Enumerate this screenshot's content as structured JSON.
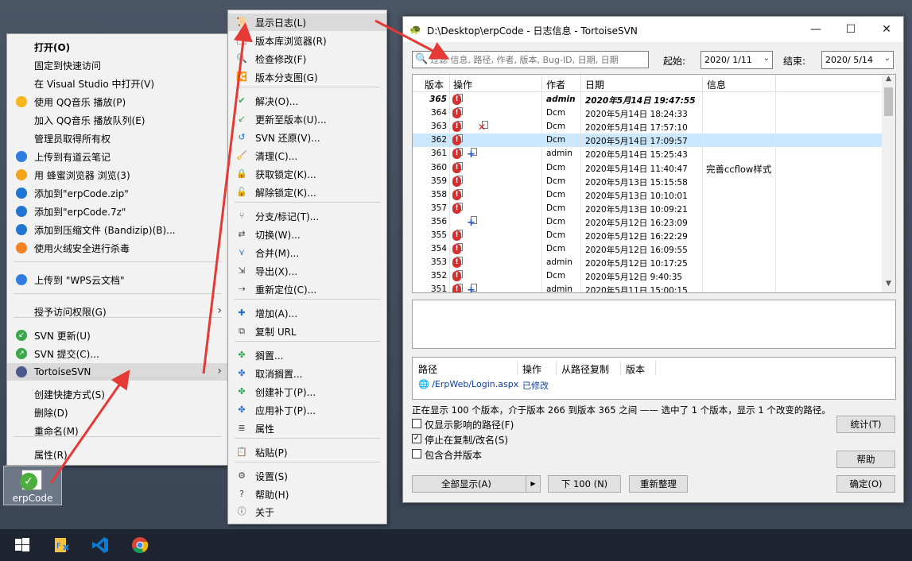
{
  "desktop_icon": {
    "label": "erpCode"
  },
  "context_menu": {
    "items": [
      {
        "label": "打开(O)",
        "bold": true
      },
      {
        "label": "固定到快速访问"
      },
      {
        "label": "在 Visual Studio 中打开(V)"
      },
      {
        "label": "使用 QQ音乐 播放(P)",
        "icon": "qq-music-icon"
      },
      {
        "label": "加入 QQ音乐 播放队列(E)"
      },
      {
        "label": "管理员取得所有权"
      },
      {
        "label": "上传到有道云笔记",
        "icon": "youdao-note-icon"
      },
      {
        "label": "用 蜂蜜浏览器 浏览(3)",
        "icon": "honeyview-icon"
      },
      {
        "label": "添加到\"erpCode.zip\"",
        "icon": "bandizip-icon"
      },
      {
        "label": "添加到\"erpCode.7z\"",
        "icon": "bandizip-icon"
      },
      {
        "label": "添加到压缩文件 (Bandizip)(B)...",
        "icon": "bandizip-icon"
      },
      {
        "label": "使用火绒安全进行杀毒",
        "icon": "huorong-icon"
      },
      {
        "label": "上传到 \"WPS云文档\"",
        "icon": "wps-cloud-icon"
      },
      {
        "label": "授予访问权限(G)",
        "submenu": true
      },
      {
        "label": "SVN 更新(U)",
        "icon": "svn-update-icon"
      },
      {
        "label": "SVN 提交(C)...",
        "icon": "svn-commit-icon"
      },
      {
        "label": "TortoiseSVN",
        "icon": "tortoisesvn-icon",
        "submenu": true,
        "highlighted": true
      },
      {
        "label": "创建快捷方式(S)"
      },
      {
        "label": "删除(D)"
      },
      {
        "label": "重命名(M)"
      },
      {
        "label": "属性(R)"
      }
    ]
  },
  "svn_menu": {
    "items": [
      {
        "label": "显示日志(L)",
        "icon": "show-log-icon",
        "highlighted": true
      },
      {
        "label": "版本库浏览器(R)",
        "icon": "repo-browser-icon"
      },
      {
        "label": "检查修改(F)",
        "icon": "check-modifications-icon"
      },
      {
        "label": "版本分支图(G)",
        "icon": "revision-graph-icon"
      },
      {
        "label": "解决(O)...",
        "icon": "resolve-icon"
      },
      {
        "label": "更新至版本(U)...",
        "icon": "update-to-revision-icon"
      },
      {
        "label": "SVN 还原(V)...",
        "icon": "revert-icon"
      },
      {
        "label": "清理(C)...",
        "icon": "cleanup-icon"
      },
      {
        "label": "获取锁定(K)...",
        "icon": "get-lock-icon"
      },
      {
        "label": "解除锁定(K)...",
        "icon": "release-lock-icon"
      },
      {
        "label": "分支/标记(T)...",
        "icon": "branch-tag-icon"
      },
      {
        "label": "切换(W)...",
        "icon": "switch-icon"
      },
      {
        "label": "合并(M)...",
        "icon": "merge-icon"
      },
      {
        "label": "导出(X)...",
        "icon": "export-icon"
      },
      {
        "label": "重新定位(C)...",
        "icon": "relocate-icon"
      },
      {
        "label": "增加(A)...",
        "icon": "add-icon"
      },
      {
        "label": "复制 URL",
        "icon": "copy-url-icon"
      },
      {
        "label": "搁置...",
        "icon": "shelve-icon"
      },
      {
        "label": "取消搁置...",
        "icon": "unshelve-icon"
      },
      {
        "label": "创建补丁(P)...",
        "icon": "create-patch-icon"
      },
      {
        "label": "应用补丁(P)...",
        "icon": "apply-patch-icon"
      },
      {
        "label": "属性",
        "icon": "properties-icon"
      },
      {
        "label": "粘贴(P)",
        "icon": "paste-icon"
      },
      {
        "label": "设置(S)",
        "icon": "settings-icon"
      },
      {
        "label": "帮助(H)",
        "icon": "help-icon"
      },
      {
        "label": "关于",
        "icon": "about-icon"
      }
    ]
  },
  "log_window": {
    "title": "D:\\Desktop\\erpCode - 日志信息 - TortoiseSVN",
    "filter_placeholder": "过滤 信息, 路径, 作者, 版本, Bug-ID, 日期, 日期",
    "from_label": "起始:",
    "from_date": "2020/ 1/11",
    "to_label": "结束:",
    "to_date": "2020/ 5/14",
    "columns": [
      "版本",
      "操作",
      "作者",
      "日期",
      "信息"
    ],
    "rows": [
      {
        "rev": "365",
        "actions": [
          "modified"
        ],
        "author": "admin",
        "date": "2020年5月14日 19:47:55",
        "msg": "",
        "bold": true
      },
      {
        "rev": "364",
        "actions": [
          "modified"
        ],
        "author": "Dcm",
        "date": "2020年5月14日 18:24:33",
        "msg": ""
      },
      {
        "rev": "363",
        "actions": [
          "modified",
          "deleted"
        ],
        "author": "Dcm",
        "date": "2020年5月14日 17:57:10",
        "msg": ""
      },
      {
        "rev": "362",
        "actions": [
          "modified"
        ],
        "author": "Dcm",
        "date": "2020年5月14日 17:09:57",
        "msg": "",
        "selected": true
      },
      {
        "rev": "361",
        "actions": [
          "modified",
          "added"
        ],
        "author": "admin",
        "date": "2020年5月14日 15:25:43",
        "msg": ""
      },
      {
        "rev": "360",
        "actions": [
          "modified"
        ],
        "author": "Dcm",
        "date": "2020年5月14日 11:40:47",
        "msg": "完善ccflow样式"
      },
      {
        "rev": "359",
        "actions": [
          "modified"
        ],
        "author": "Dcm",
        "date": "2020年5月13日 15:15:58",
        "msg": ""
      },
      {
        "rev": "358",
        "actions": [
          "modified"
        ],
        "author": "Dcm",
        "date": "2020年5月13日 10:10:01",
        "msg": ""
      },
      {
        "rev": "357",
        "actions": [
          "modified"
        ],
        "author": "Dcm",
        "date": "2020年5月13日 10:09:21",
        "msg": ""
      },
      {
        "rev": "356",
        "actions": [
          "added"
        ],
        "author": "Dcm",
        "date": "2020年5月12日 16:23:09",
        "msg": ""
      },
      {
        "rev": "355",
        "actions": [
          "modified"
        ],
        "author": "Dcm",
        "date": "2020年5月12日 16:22:29",
        "msg": ""
      },
      {
        "rev": "354",
        "actions": [
          "modified"
        ],
        "author": "Dcm",
        "date": "2020年5月12日 16:09:55",
        "msg": ""
      },
      {
        "rev": "353",
        "actions": [
          "modified"
        ],
        "author": "admin",
        "date": "2020年5月12日 10:17:25",
        "msg": ""
      },
      {
        "rev": "352",
        "actions": [
          "modified"
        ],
        "author": "Dcm",
        "date": "2020年5月12日 9:40:35",
        "msg": ""
      },
      {
        "rev": "351",
        "actions": [
          "modified",
          "added"
        ],
        "author": "admin",
        "date": "2020年5月11日 15:00:15",
        "msg": ""
      }
    ],
    "path_columns": [
      "路径",
      "操作",
      "从路径复制",
      "版本"
    ],
    "path_row": {
      "path": "/ErpWeb/Login.aspx",
      "action": "已修改"
    },
    "status_text": "正在显示 100 个版本，介于版本 266 到版本 365 之间 —— 选中了 1 个版本，显示 1 个改变的路径。",
    "options": [
      {
        "label": "仅显示影响的路径(F)",
        "checked": false
      },
      {
        "label": "停止在复制/改名(S)",
        "checked": true
      },
      {
        "label": "包含合并版本",
        "checked": false
      }
    ],
    "buttons": {
      "show_all": "全部显示(A)",
      "next_100": "下 100 (N)",
      "refresh": "重新整理",
      "stats": "统计(T)",
      "help": "帮助",
      "ok": "确定(O)"
    }
  },
  "colors": {
    "arrow": "#e53935",
    "selection": "#cce8ff",
    "menu_highlight": "#dadada"
  }
}
